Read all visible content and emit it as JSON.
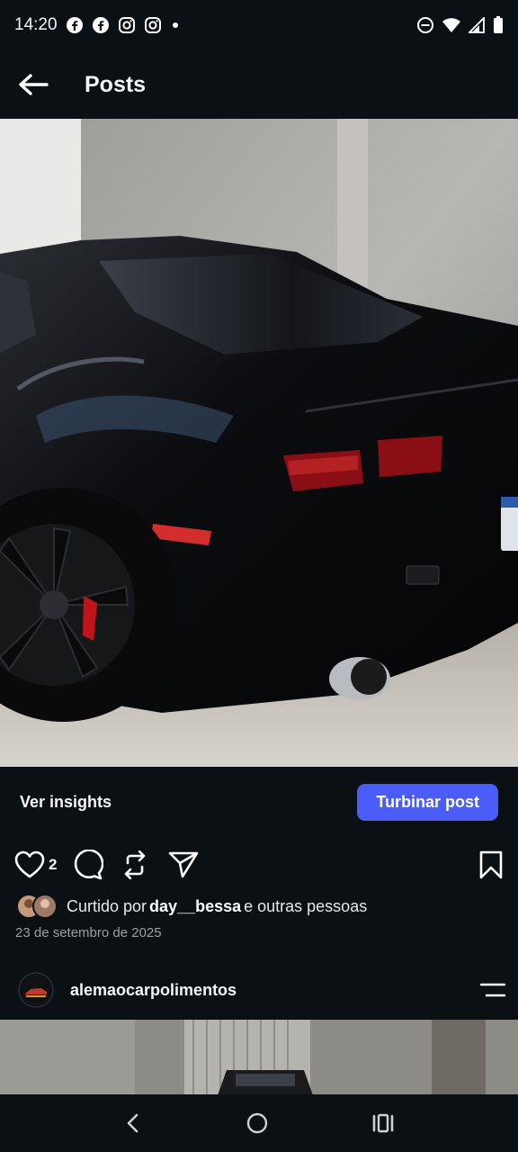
{
  "status_bar": {
    "time": "14:20",
    "notification_icons": [
      "facebook-icon",
      "facebook-icon",
      "instagram-icon",
      "instagram-icon",
      "dot-icon"
    ],
    "system_icons": [
      "do-not-disturb-icon",
      "wifi-icon",
      "signal-icon",
      "battery-icon"
    ]
  },
  "header": {
    "title": "Posts",
    "back_icon": "arrow-left-icon"
  },
  "post": {
    "insights_label": "Ver insights",
    "boost_label": "Turbinar post",
    "like_count": "2",
    "liked_prefix": "Curtido por ",
    "liked_user": "day__bessa",
    "liked_suffix": " e outras pessoas",
    "date": "23 de setembro de 2025"
  },
  "next_post": {
    "username": "alemaocarpolimentos"
  },
  "colors": {
    "background": "#0b1014",
    "accent": "#4a5df9",
    "muted_text": "#9aa0a6"
  }
}
